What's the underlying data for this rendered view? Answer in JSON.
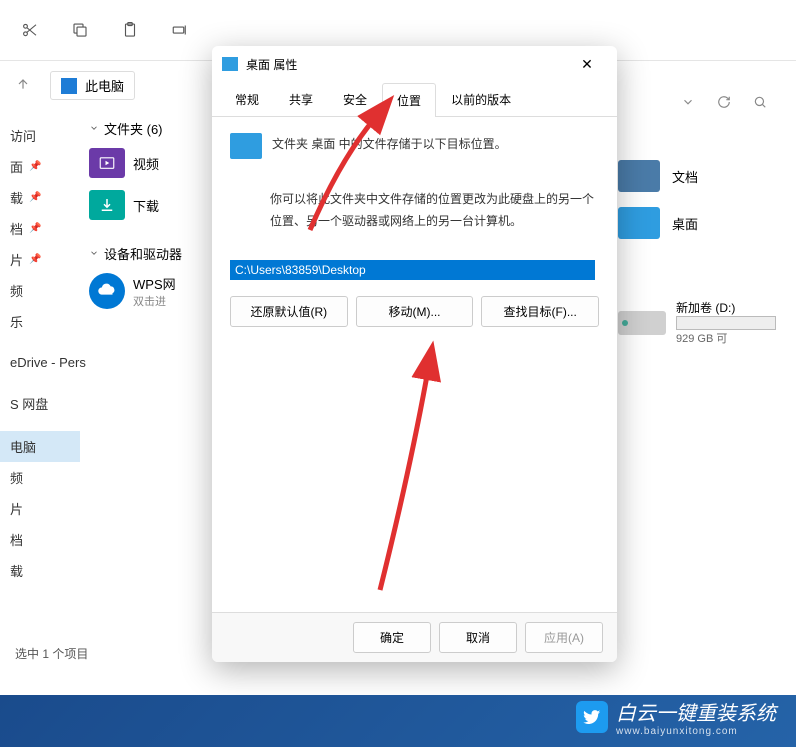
{
  "explorer": {
    "address": "此电脑",
    "sidebar": {
      "items": [
        {
          "label": "访问"
        },
        {
          "label": "面",
          "pinned": true
        },
        {
          "label": "载",
          "pinned": true
        },
        {
          "label": "档",
          "pinned": true
        },
        {
          "label": "片",
          "pinned": true
        },
        {
          "label": "频"
        },
        {
          "label": "乐"
        },
        {
          "label": "eDrive - Pers"
        },
        {
          "label": "S 网盘"
        },
        {
          "label": "电脑",
          "active": true
        },
        {
          "label": "频"
        },
        {
          "label": "片"
        },
        {
          "label": "档"
        },
        {
          "label": "载"
        }
      ]
    },
    "tree": {
      "folders_label": "文件夹 (6)",
      "devices_label": "设备和驱动器",
      "video": "视频",
      "download": "下载",
      "wps": "WPS网",
      "wps_sub": "双击进"
    },
    "right": {
      "docs": "文档",
      "desktop": "桌面",
      "drive_name": "新加卷 (D:)",
      "drive_free": "929 GB 可"
    },
    "status": "选中 1 个项目"
  },
  "dialog": {
    "title": "桌面 属性",
    "tabs": [
      "常规",
      "共享",
      "安全",
      "位置",
      "以前的版本"
    ],
    "active_tab": 3,
    "info_text": "文件夹 桌面 中的文件存储于以下目标位置。",
    "description": "你可以将此文件夹中文件存储的位置更改为此硬盘上的另一个位置、另一个驱动器或网络上的另一台计算机。",
    "path": "C:\\Users\\83859\\Desktop",
    "buttons": {
      "restore": "还原默认值(R)",
      "move": "移动(M)...",
      "find": "查找目标(F)..."
    },
    "footer": {
      "ok": "确定",
      "cancel": "取消",
      "apply": "应用(A)"
    }
  },
  "watermark": {
    "text": "白云一键重装系统",
    "url": "www.baiyunxitong.com"
  }
}
